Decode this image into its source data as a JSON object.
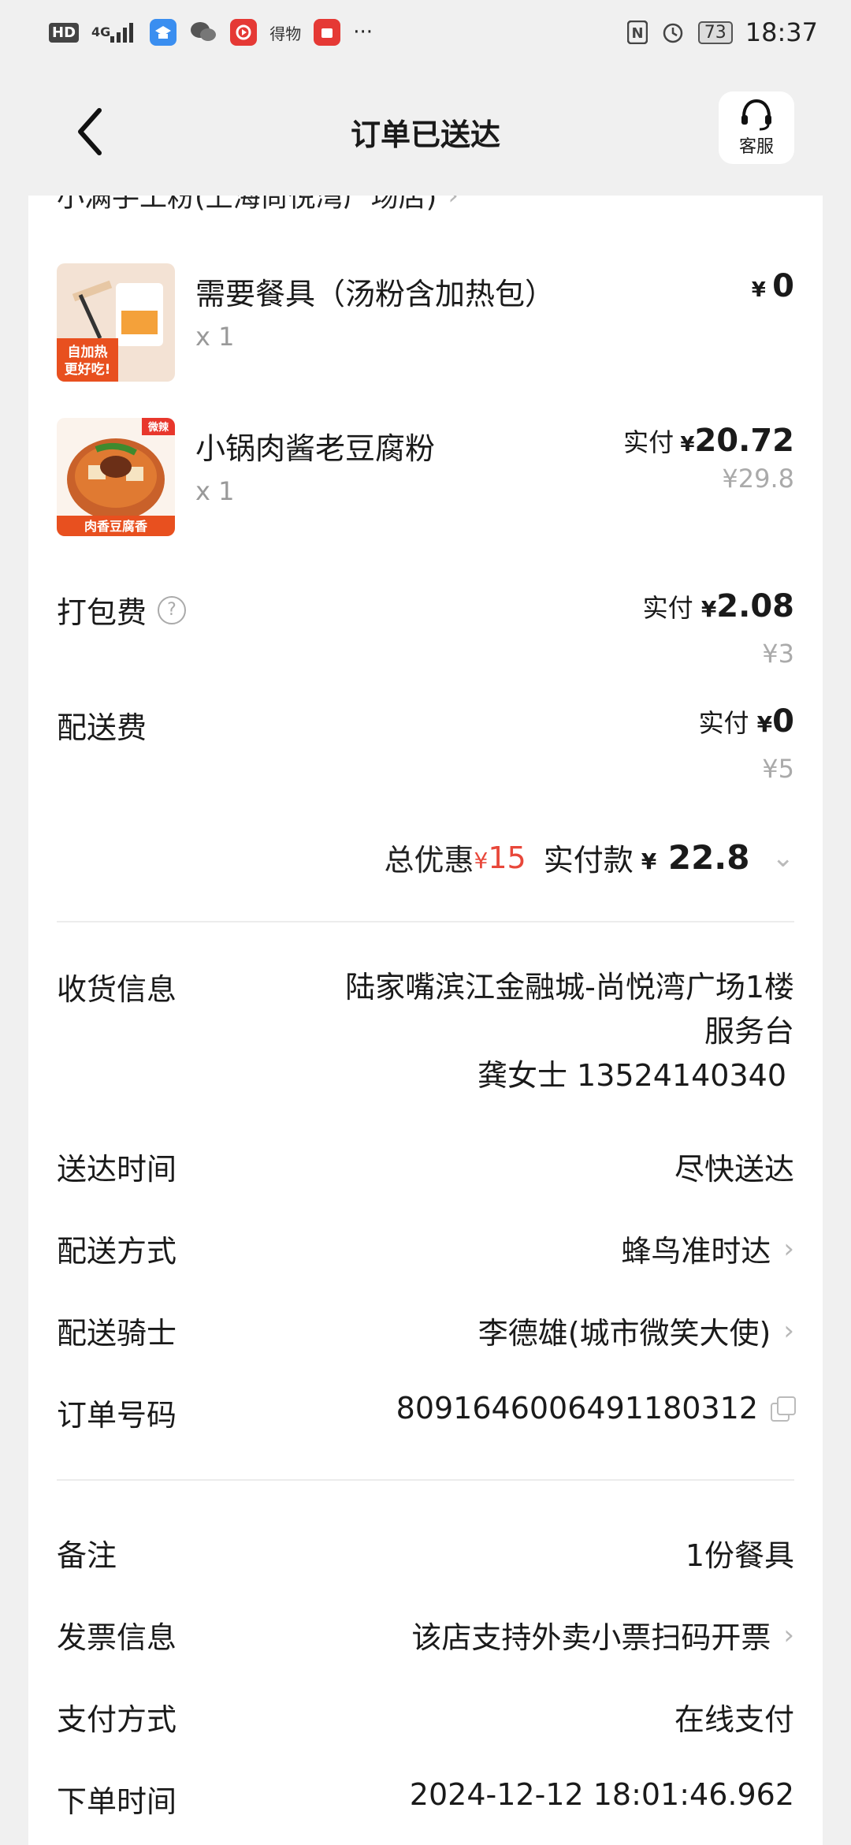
{
  "status_bar": {
    "hd": "HD",
    "net": "4G",
    "app_dewu": "得物",
    "more": "···",
    "nfc": "N",
    "battery": "73",
    "time": "18:37"
  },
  "header": {
    "title": "订单已送达",
    "service_label": "客服"
  },
  "shop": {
    "name": "小满手工粉(上海尚悦湾广场店)"
  },
  "items": [
    {
      "name": "需要餐具（汤粉含加热包）",
      "qty": "x 1",
      "price_yen": "¥",
      "price": "0",
      "thumb_text_1": "自加热",
      "thumb_text_2": "更好吃!"
    },
    {
      "name": "小锅肉酱老豆腐粉",
      "qty": "x 1",
      "paid_label": "实付",
      "price_yen": "¥",
      "price": "20.72",
      "orig_price": "¥29.8",
      "thumb_tag": "微辣",
      "thumb_caption": "肉香豆腐香"
    }
  ],
  "fees": {
    "packing": {
      "label": "打包费",
      "paid_label": "实付",
      "yen": "¥",
      "paid": "2.08",
      "orig": "¥3"
    },
    "delivery": {
      "label": "配送费",
      "paid_label": "实付",
      "yen": "¥",
      "paid": "0",
      "orig": "¥5"
    }
  },
  "totals": {
    "discount_label": "总优惠",
    "discount_yen": "¥",
    "discount": "15",
    "paid_label": "实付款",
    "paid_yen": "¥",
    "paid": "22.8"
  },
  "info": {
    "address": {
      "label": "收货信息",
      "line1": "陆家嘴滨江金融城-尚悦湾广场1楼",
      "line2": "服务台",
      "line3": "龚女士 13524140340"
    },
    "delivery_time": {
      "label": "送达时间",
      "value": "尽快送达"
    },
    "delivery_method": {
      "label": "配送方式",
      "value": "蜂鸟准时达"
    },
    "rider": {
      "label": "配送骑士",
      "value": "李德雄(城市微笑大使)"
    },
    "order_no": {
      "label": "订单号码",
      "value": "8091646006491180312"
    }
  },
  "extra": {
    "remark": {
      "label": "备注",
      "value": "1份餐具"
    },
    "invoice": {
      "label": "发票信息",
      "value": "该店支持外卖小票扫码开票"
    },
    "payment": {
      "label": "支付方式",
      "value": "在线支付"
    },
    "order_time": {
      "label": "下单时间",
      "value": "2024-12-12 18:01:46.962"
    }
  },
  "colors": {
    "accent_red": "#e8473a",
    "muted_gray": "#aaaaaa",
    "background": "#f0f0f0"
  }
}
